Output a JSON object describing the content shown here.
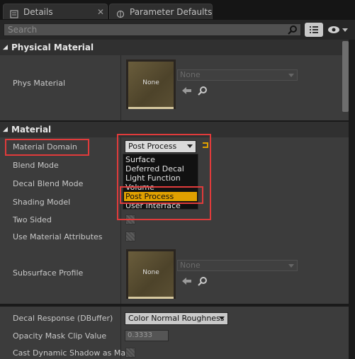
{
  "tabs": [
    {
      "label": "Details"
    },
    {
      "label": "Parameter Defaults"
    }
  ],
  "search": {
    "placeholder": "Search"
  },
  "physical_material": {
    "header": "Physical Material",
    "phys_material_label": "Phys Material",
    "thumbnail_label": "None",
    "dropdown_value": "None"
  },
  "material": {
    "header": "Material",
    "properties": [
      "Material Domain",
      "Blend Mode",
      "Decal Blend Mode",
      "Shading Model",
      "Two Sided",
      "Use Material Attributes"
    ],
    "material_domain_value": "Post Process",
    "menu_options": [
      "Surface",
      "Deferred Decal",
      "Light Function",
      "Volume",
      "Post Process",
      "User Interface"
    ],
    "selected_option": "Post Process",
    "subsurface_profile_label": "Subsurface Profile",
    "subsurface_thumbnail_label": "None",
    "subsurface_dropdown_value": "None",
    "decal_response_label": "Decal Response (DBuffer)",
    "decal_response_value": "Color Normal Roughness",
    "opacity_mask_label": "Opacity Mask Clip Value",
    "opacity_mask_value": "0.3333",
    "cast_shadow_label": "Cast Dynamic Shadow as Mas"
  },
  "colors": {
    "highlight": "#e0a000",
    "annotation": "#e03b3b"
  }
}
